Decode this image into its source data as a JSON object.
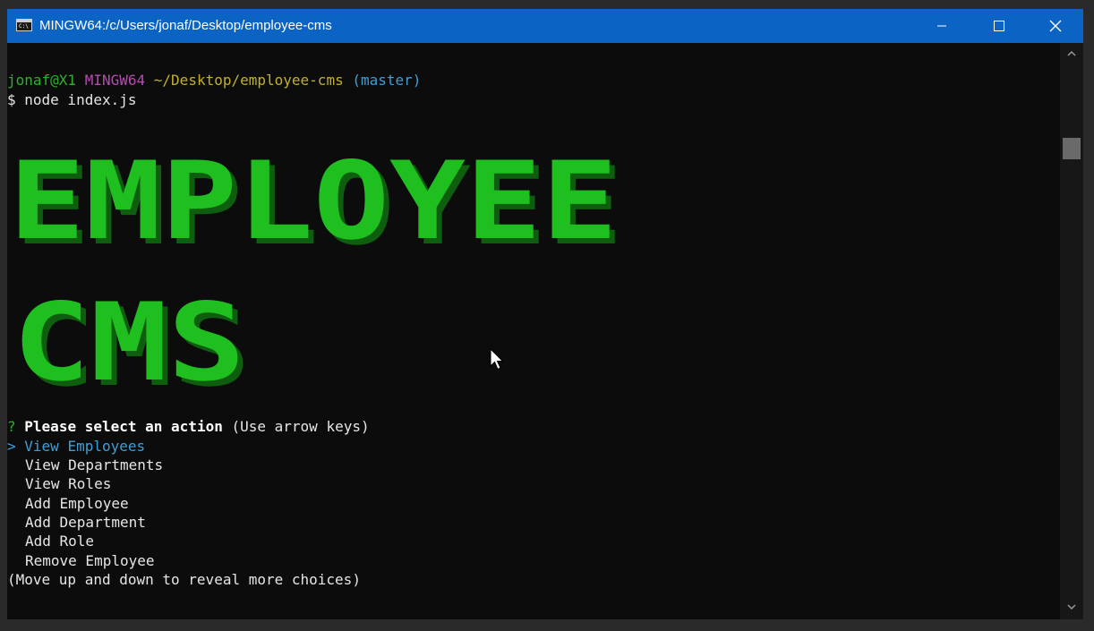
{
  "window": {
    "title": "MINGW64:/c/Users/jonaf/Desktop/employee-cms",
    "app_icon_text": "C:\\",
    "buttons": [
      "minimize",
      "maximize",
      "close"
    ]
  },
  "prompt": {
    "user_host": "jonaf@X1",
    "shell": "MINGW64",
    "path": "~/Desktop/employee-cms",
    "branch": "(master)",
    "command_line": "$ node index.js"
  },
  "banner": {
    "line1": "EMPLOYEE",
    "line2": "CMS",
    "color": "#1fbf1f",
    "shadow_color": "#0f5e0f"
  },
  "menu": {
    "question_mark": "?",
    "question": "Please select an action",
    "hint": "(Use arrow keys)",
    "pointer": ">",
    "selected_index": 0,
    "options": [
      "View Employees",
      "View Departments",
      "View Roles",
      "Add Employee",
      "Add Department",
      "Add Role",
      "Remove Employee"
    ],
    "footer": "(Move up and down to reveal more choices)"
  },
  "colors": {
    "titlebar": "#0b63c4",
    "terminal_bg": "#0c0c0c",
    "prompt_green": "#2bb32b",
    "prompt_magenta": "#b44bb0",
    "prompt_yellow": "#c2b12a",
    "prompt_cyan": "#3d9fd6"
  }
}
